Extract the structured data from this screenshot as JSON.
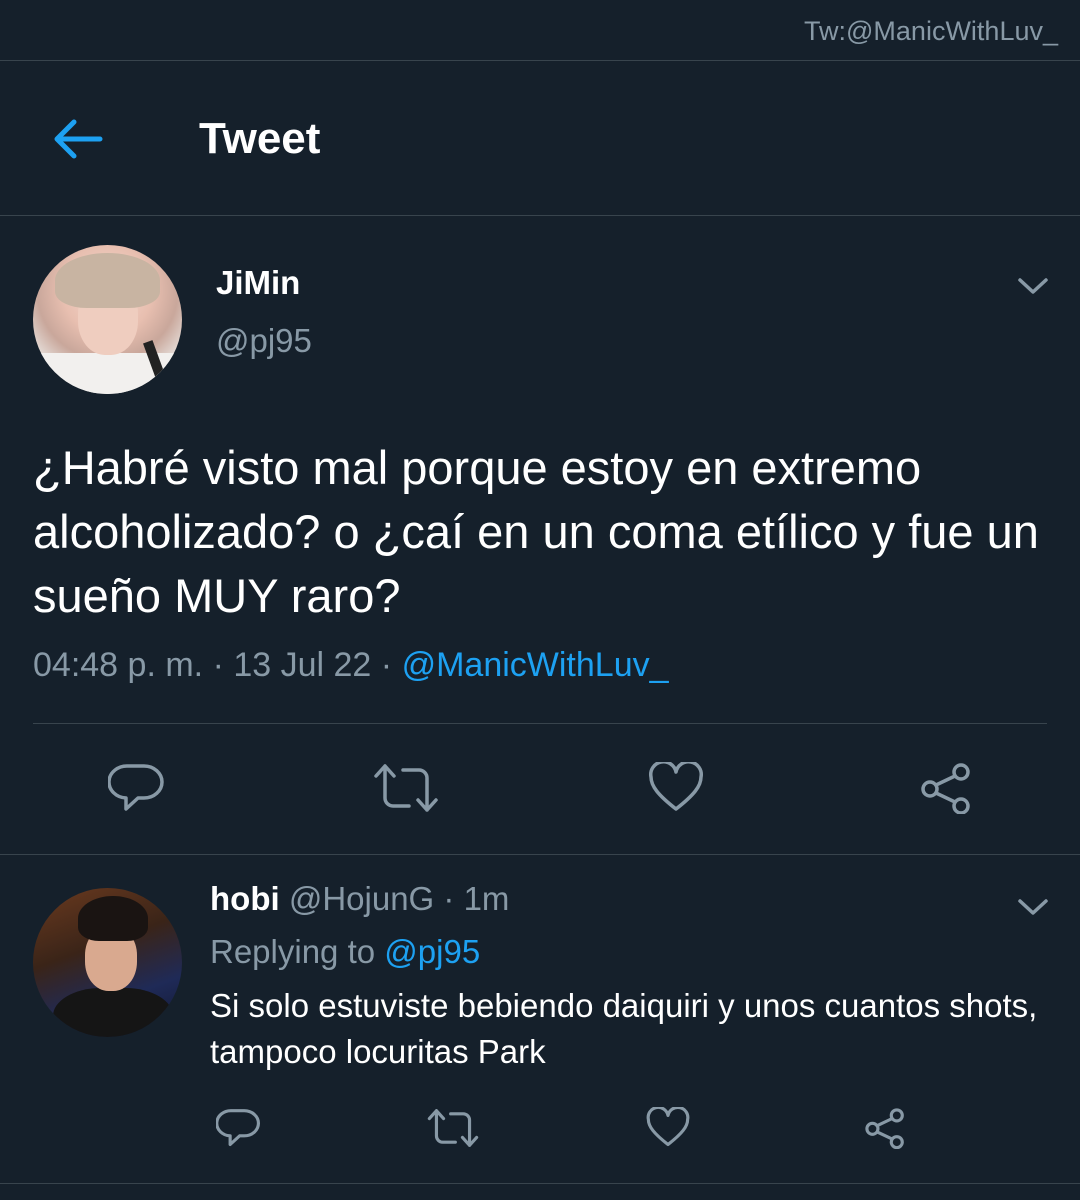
{
  "watermark": "Tw:@ManicWithLuv_",
  "header": {
    "title": "Tweet",
    "back_icon": "back-arrow-icon"
  },
  "tweet": {
    "display_name": "JiMin",
    "handle": "@pj95",
    "text": "¿Habré visto mal porque estoy en extremo alcoholizado? o ¿caí en un coma etílico y fue un sueño MUY raro?",
    "time": "04:48 p. m.",
    "date": "13 Jul 22",
    "via": "@ManicWithLuv_",
    "actions": [
      "reply-icon",
      "retweet-icon",
      "like-icon",
      "share-icon"
    ]
  },
  "reply": {
    "display_name": "hobi",
    "handle": "@HojunG",
    "age": "1m",
    "replying_prefix": "Replying to",
    "replying_to": "@pj95",
    "text": "Si solo estuviste bebiendo daiquiri y unos cuantos shots, tampoco locuritas Park",
    "actions": [
      "reply-icon",
      "retweet-icon",
      "like-icon",
      "share-icon"
    ]
  },
  "colors": {
    "background": "#15202b",
    "accent": "#1da1f2",
    "secondary_text": "#8899a6",
    "divider": "#38444d"
  }
}
